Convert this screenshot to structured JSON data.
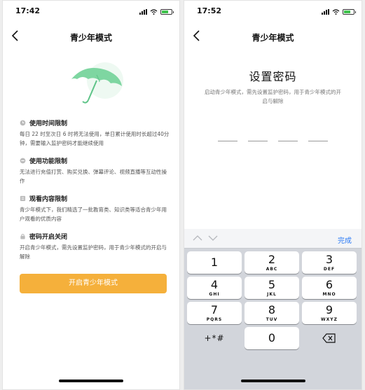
{
  "left": {
    "status": {
      "time": "17:42"
    },
    "nav": {
      "title": "青少年模式"
    },
    "sections": [
      {
        "title": "使用时间限制",
        "body": "每日 22 时至次日 6 时将无法使用，单日累计使用时长超过40分钟，需要输入监护密码才能继续使用",
        "icon": "clock-icon"
      },
      {
        "title": "使用功能限制",
        "body": "无法进行充值打赏、购买兑换、弹幕评论、视频直播等互动性操作",
        "icon": "block-icon"
      },
      {
        "title": "观看内容限制",
        "body": "青少年模式下，我们精选了一批教育类、知识类等适合青少年用户观看的优质内容",
        "icon": "book-icon"
      },
      {
        "title": "密码开启关闭",
        "body": "开启青少年模式，需先设置监护密码，用于青少年模式的开启与解除",
        "icon": "lock-icon"
      }
    ],
    "button_label": "开启青少年模式",
    "colors": {
      "accent": "#f5b03b",
      "umbrella": "#7ed6a1"
    }
  },
  "right": {
    "status": {
      "time": "17:52"
    },
    "nav": {
      "title": "青少年模式"
    },
    "heading": "设置密码",
    "description": "启动青少年模式，需先设置监护密码，用于青少年模式的开启与解除",
    "keyboard": {
      "done_label": "完成",
      "keys": [
        {
          "num": "1",
          "letters": ""
        },
        {
          "num": "2",
          "letters": "ABC"
        },
        {
          "num": "3",
          "letters": "DEF"
        },
        {
          "num": "4",
          "letters": "GHI"
        },
        {
          "num": "5",
          "letters": "JKL"
        },
        {
          "num": "6",
          "letters": "MNO"
        },
        {
          "num": "7",
          "letters": "PQRS"
        },
        {
          "num": "8",
          "letters": "TUV"
        },
        {
          "num": "9",
          "letters": "WXYZ"
        },
        {
          "num": "0",
          "letters": ""
        }
      ],
      "symbols_label": "+*#",
      "colors": {
        "done": "#2d7cf6",
        "background": "#d2d5db"
      }
    }
  }
}
